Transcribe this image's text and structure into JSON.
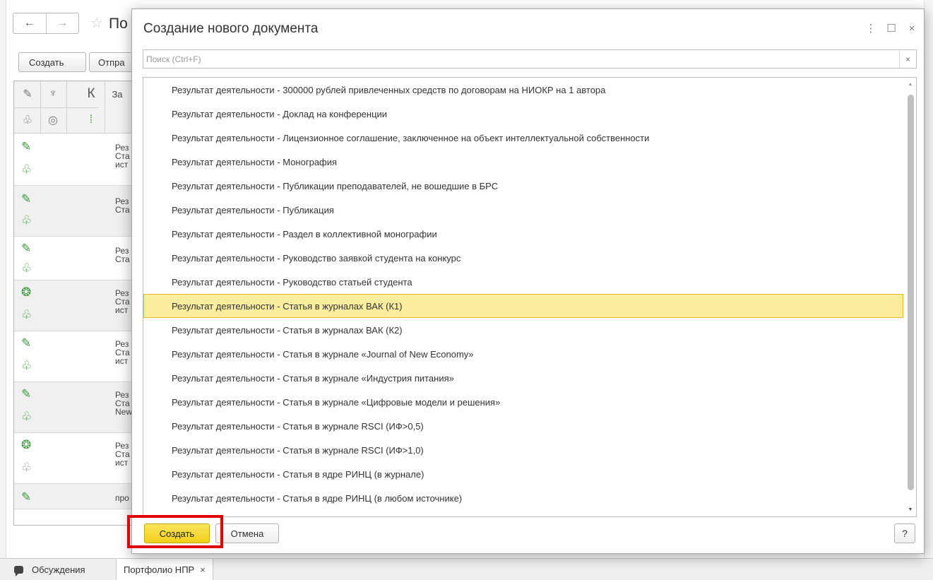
{
  "background": {
    "nav": {
      "back": "←",
      "forward": "→"
    },
    "title": "По",
    "buttons": {
      "create": "Создать",
      "send": "Отпра"
    },
    "list_header": {
      "col_title": "За",
      "k_label": "К"
    },
    "rows": [
      {
        "lines": [
          "Рез",
          "Ста",
          "ист"
        ],
        "clip": "✎",
        "people": "green"
      },
      {
        "lines": [
          "Рез",
          "Ста"
        ],
        "clip": "✎",
        "people": "green"
      },
      {
        "lines": [
          "Рез",
          "Ста"
        ],
        "clip": "✎",
        "people": "green"
      },
      {
        "lines": [
          "Рез",
          "Ста",
          "ист"
        ],
        "clip": "❂",
        "people": "green"
      },
      {
        "lines": [
          "Рез",
          "Ста",
          "ист"
        ],
        "clip": "✎",
        "people": "green"
      },
      {
        "lines": [
          "Рез",
          "Ста",
          "New"
        ],
        "clip": "✎",
        "people": "green"
      },
      {
        "lines": [
          "Рез",
          "Ста",
          "ист"
        ],
        "clip": "❂",
        "people": "gray"
      },
      {
        "lines": [
          "про"
        ],
        "clip": "✎",
        "people": "none"
      }
    ],
    "bottom_tabs": {
      "discussions": "Обсуждения",
      "portfolio": "Портфолио НПР",
      "close": "×"
    }
  },
  "dialog": {
    "title": "Создание нового документа",
    "controls": {
      "more": "⋮",
      "maximize": "☐",
      "close": "×"
    },
    "search": {
      "placeholder": "Поиск (Ctrl+F)",
      "value": "",
      "clear": "×"
    },
    "items": [
      "Результат деятельности - 300000 рублей привлеченных средств по договорам на НИОКР на 1 автора",
      "Результат деятельности - Доклад на конференции",
      "Результат деятельности - Лицензионное соглашение, заключенное на объект интеллектуальной собственности",
      "Результат деятельности - Монография",
      "Результат деятельности - Публикации преподавателей, не вошедшие в БРС",
      "Результат деятельности - Публикация",
      "Результат деятельности - Раздел в коллективной монографии",
      "Результат деятельности - Руководство заявкой студента на конкурс",
      "Результат деятельности - Руководство статьей студента",
      "Результат деятельности - Статья в журналах ВАК (К1)",
      "Результат деятельности - Статья в журналах ВАК (К2)",
      "Результат деятельности - Статья в журнале «Journal of New Economy»",
      "Результат деятельности - Статья в журнале «Индустрия питания»",
      "Результат деятельности - Статья в журнале «Цифровые модели и решения»",
      "Результат деятельности - Статья в журнале RSCI (ИФ>0,5)",
      "Результат деятельности - Статья в журнале RSCI (ИФ>1,0)",
      "Результат деятельности - Статья в ядре РИНЦ (в журнале)",
      "Результат деятельности - Статья в ядре РИНЦ (в любом источнике)"
    ],
    "selected_index": 9,
    "buttons": {
      "create": "Создать",
      "cancel": "Отмена",
      "help": "?"
    }
  },
  "colors": {
    "selection_bg": "#fbed9e",
    "selection_border": "#e8b926",
    "primary_button": "#f2cf1a",
    "highlight_frame": "#e00000",
    "icon_green": "#3a9a3a"
  }
}
